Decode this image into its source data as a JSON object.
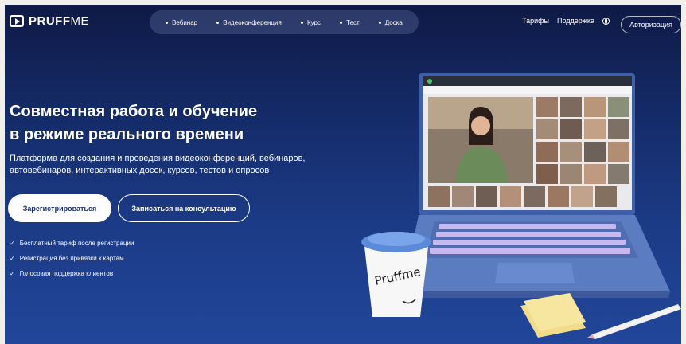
{
  "brand": {
    "name_bold": "PRUFF",
    "name_light": "ME"
  },
  "nav": {
    "items": [
      "Вебинар",
      "Видеоконференция",
      "Курс",
      "Тест",
      "Доска"
    ]
  },
  "header": {
    "tariffs": "Тарифы",
    "support": "Поддержка",
    "login": "Авторизация"
  },
  "hero": {
    "title_line1": "Совместная работа и обучение",
    "title_line2": "в режиме реального времени",
    "subtitle_line1": "Платформа для создания и проведения видеоконференций, вебинаров,",
    "subtitle_line2": "автовебинаров, интерактивных досок, курсов, тестов и опросов",
    "register_button": "Зарегистрироваться",
    "consult_button": "Записаться на консультацию",
    "features": [
      "Бесплатный тариф после регистрации",
      "Регистрация без привязки к картам",
      "Голосовая поддержка клиентов"
    ]
  },
  "illustration": {
    "cup_text": "Pruffme"
  },
  "colors": {
    "background_top": "#0f1a45",
    "background_bottom": "#21469a",
    "laptop": "#5b7cc0",
    "keys": "#c7b8f0",
    "note": "#f6e6a0"
  },
  "icons": [
    "play-logo-icon",
    "globe-icon",
    "check-icon"
  ]
}
